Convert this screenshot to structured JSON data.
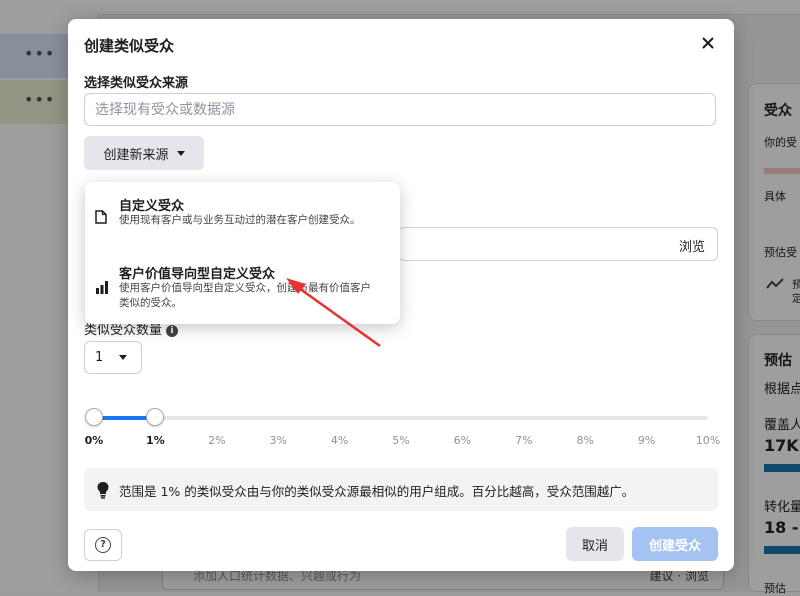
{
  "modal": {
    "title": "创建类似受众",
    "source_section_label": "选择类似受众来源",
    "source_input_placeholder": "选择现有受众或数据源",
    "create_source_button": "创建新来源",
    "browse_label": "浏览",
    "count_label": "类似受众数量",
    "count_value": "1",
    "slider": {
      "ticks": [
        "0%",
        "1%",
        "2%",
        "3%",
        "4%",
        "5%",
        "6%",
        "7%",
        "8%",
        "9%",
        "10%"
      ],
      "range_start_percent": 0,
      "range_end_percent": 1
    },
    "tip_text": "范围是 1% 的类似受众由与你的类似受众源最相似的用户组成。百分比越高，受众范围越广。",
    "cancel_button": "取消",
    "create_button": "创建受众"
  },
  "dropdown": {
    "items": [
      {
        "title": "自定义受众",
        "description": "使用现有客户或与业务互动过的潜在客户创建受众。",
        "icon": "document-icon"
      },
      {
        "title": "客户价值导向型自定义受众",
        "description": "使用客户价值导向型自定义受众，创建与最有价值客户类似的受众。",
        "icon": "bar-chart-icon"
      }
    ]
  },
  "background": {
    "right_panel": {
      "card1_title": "受众",
      "card1_sub": "你的受",
      "card1_specific": "具体",
      "card1_estimate": "预估受",
      "card1_pred": "预",
      "card1_pred2": "定",
      "card2_title": "预估",
      "card2_sub": "根据点",
      "card2_reach_label": "覆盖人",
      "card2_reach_value": "17K",
      "card2_conv_label": "转化量",
      "card2_conv_value": "18 -",
      "card2_more": "预估"
    },
    "search_placeholder": "添加人口统计数据、兴趣或行为",
    "search_actions": "建议 · 浏览"
  },
  "colors": {
    "primary": "#1877f2",
    "primary_disabled": "#a4c3f3",
    "annotation_arrow": "#e8322b"
  }
}
